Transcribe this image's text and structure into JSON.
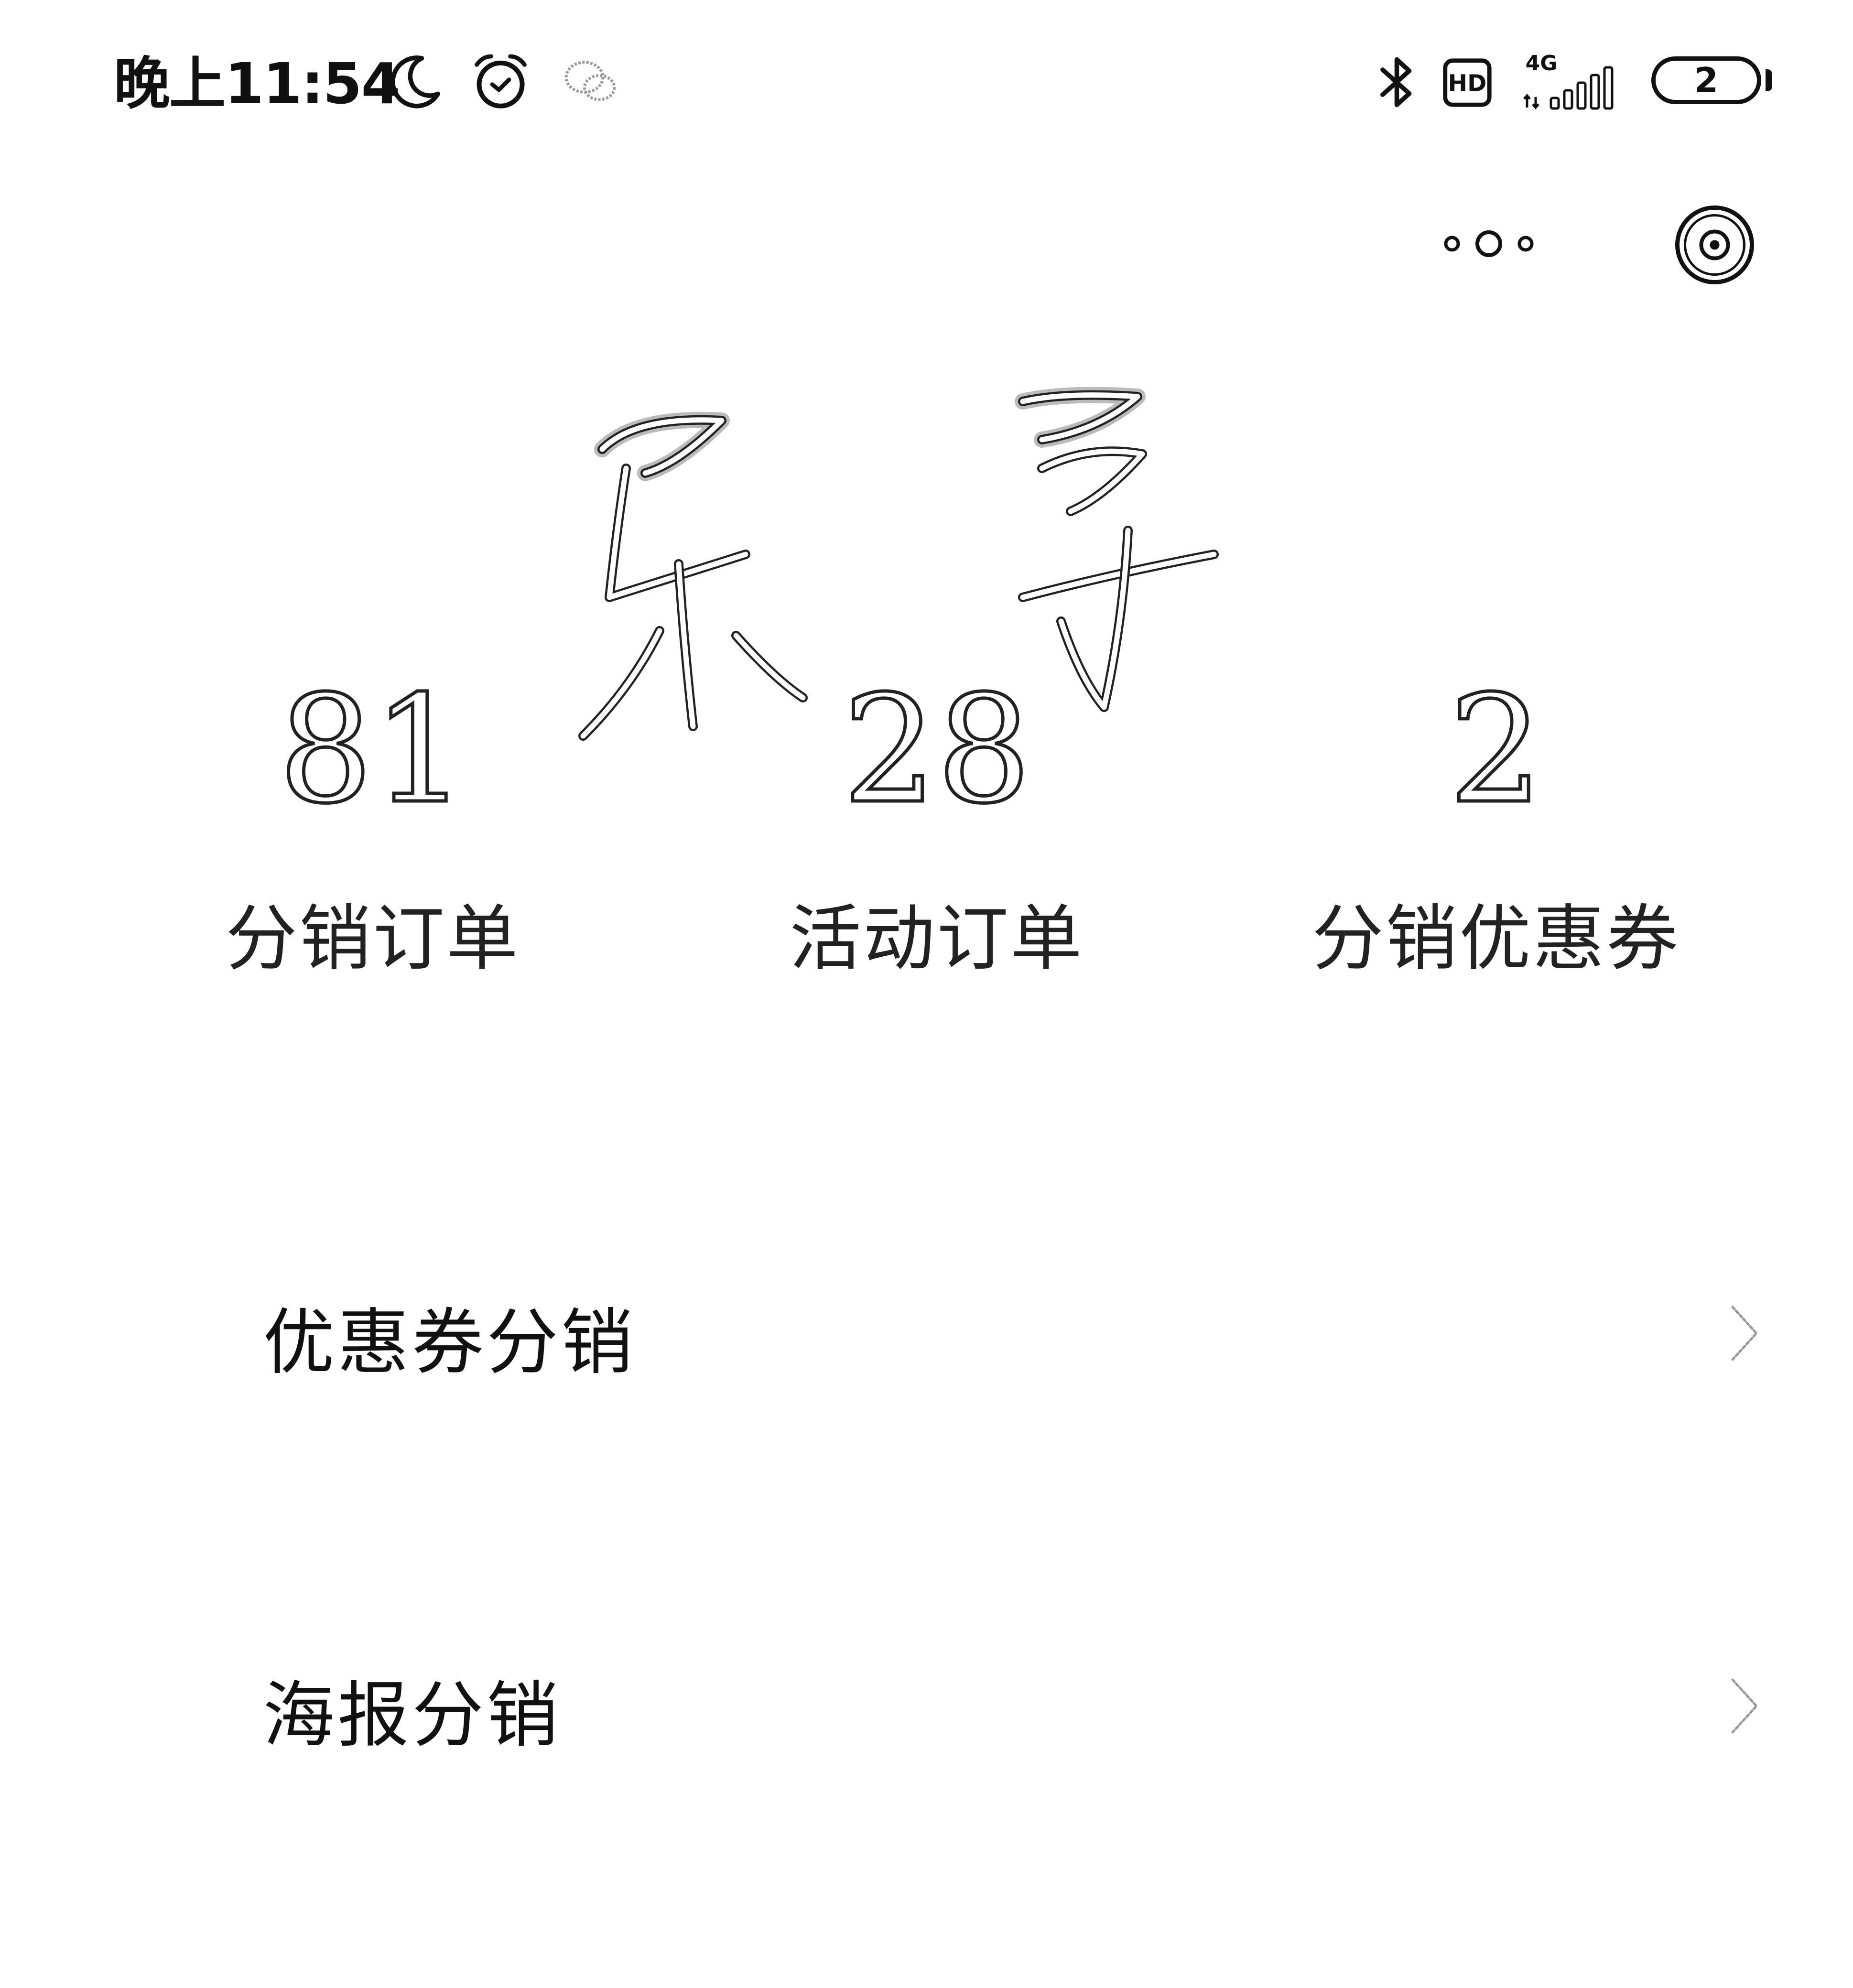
{
  "status_bar": {
    "time": "晚上11:54",
    "icons": [
      "moon-icon",
      "alarm-icon",
      "wechat-icon",
      "bluetooth-icon",
      "hd-icon",
      "4g-signal-icon"
    ],
    "network": "4G",
    "battery_text": "2"
  },
  "nav": {
    "icons": [
      "more-icon",
      "target-icon"
    ]
  },
  "stats": [
    {
      "value": "81",
      "label": "分销订单"
    },
    {
      "value": "28",
      "label": "活动订单"
    },
    {
      "value": "2",
      "label": "分销优惠券"
    }
  ],
  "menu": {
    "items": [
      {
        "label": "优惠券分销",
        "icon": "chevron-right-icon"
      },
      {
        "label": "海报分销",
        "icon": "chevron-right-icon"
      }
    ]
  },
  "colors": {
    "background": "#ffffff",
    "text": "#111111"
  }
}
